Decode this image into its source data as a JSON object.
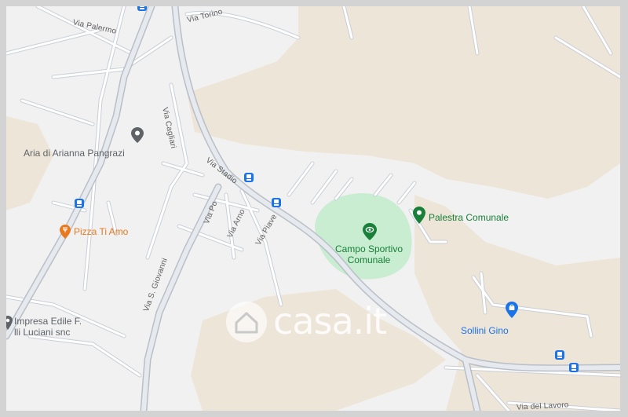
{
  "map": {
    "colors": {
      "land": "#f1f1f1",
      "terrain": "#ede5d8",
      "road": "#ffffff",
      "road_outline": "#c9ced6",
      "park": "#c8edd1",
      "border": "#d3d3d3"
    },
    "streets": {
      "via_torino": "Via Torino",
      "via_palermo": "Via Palermo",
      "via_cagliari": "Via Cagliari",
      "via_stadio": "Via Stadio",
      "via_po": "Via Po",
      "via_arno": "Via Arno",
      "via_piave": "Via Piave",
      "via_s_giovanni": "Via S. Giovanni",
      "via_lavoro": "Via del Lavoro"
    },
    "pois": {
      "aria": {
        "name": "Aria di Arianna Pangrazi",
        "icon": "map-pin-icon",
        "color": "#5f6368"
      },
      "pizza": {
        "name": "Pizza Ti Amo",
        "icon": "restaurant-icon",
        "color": "#e8791f"
      },
      "impresa": {
        "name_line1": "Impresa Edile F.",
        "name_line2": "lli Luciani snc",
        "icon": "map-pin-icon",
        "color": "#5f6368"
      },
      "campo": {
        "name_line1": "Campo Sportivo",
        "name_line2": "Comunale",
        "icon": "stadium-icon",
        "color": "#188038"
      },
      "palestra": {
        "name": "Palestra Comunale",
        "icon": "map-pin-icon",
        "color": "#188038"
      },
      "sollini": {
        "name": "Sollini Gino",
        "icon": "shopping-bag-icon",
        "color": "#1a73e8"
      }
    },
    "watermark": "casa.it"
  }
}
